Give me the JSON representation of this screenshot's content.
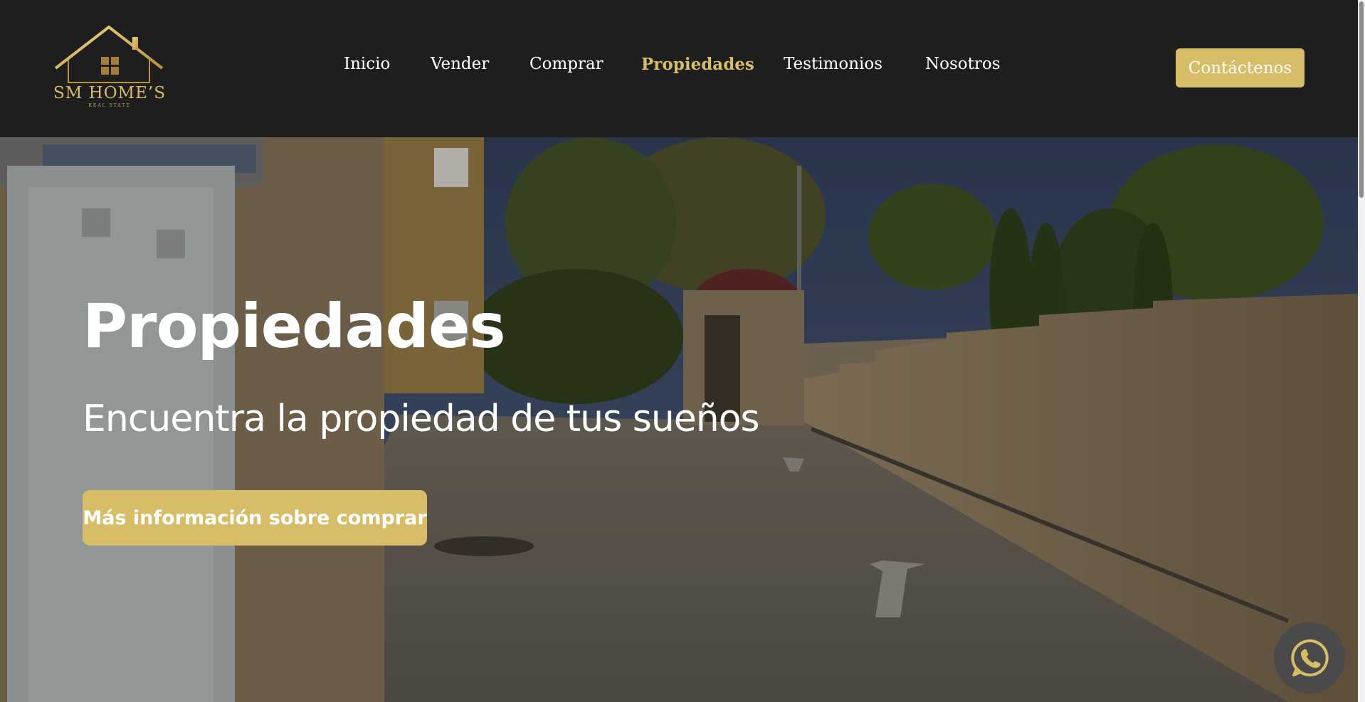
{
  "brand": {
    "name": "SM HOME’S",
    "tagline": "REAL STATE",
    "gold": "#d8bd68",
    "dark": "#1e1e1e"
  },
  "nav": {
    "items": [
      {
        "label": "Inicio"
      },
      {
        "label": "Vender"
      },
      {
        "label": "Comprar"
      },
      {
        "label": "Propiedades",
        "active": true
      },
      {
        "label": "Testimonios"
      },
      {
        "label": "Nosotros"
      }
    ],
    "contact_label": "Contáctenos"
  },
  "hero": {
    "title": "Propiedades",
    "subtitle": "Encuentra la propiedad de tus sueños",
    "button_label": "Más información sobre comprar"
  },
  "floating": {
    "icon": "whatsapp-icon"
  }
}
